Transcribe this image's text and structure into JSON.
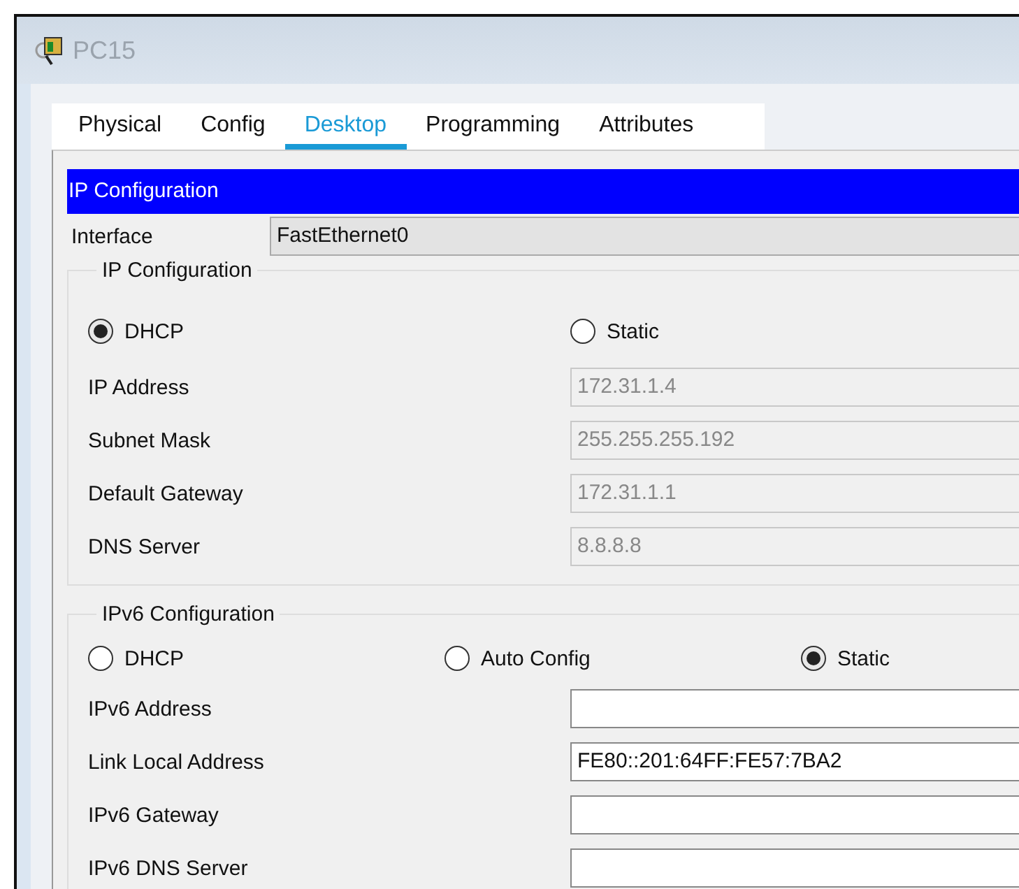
{
  "window": {
    "title": "PC15"
  },
  "tabs": [
    {
      "label": "Physical",
      "selected": false
    },
    {
      "label": "Config",
      "selected": false
    },
    {
      "label": "Desktop",
      "selected": true
    },
    {
      "label": "Programming",
      "selected": false
    },
    {
      "label": "Attributes",
      "selected": false
    }
  ],
  "header": "IP Configuration",
  "interface": {
    "label": "Interface",
    "value": "FastEthernet0"
  },
  "ipv4": {
    "title": "IP Configuration",
    "modes": [
      {
        "label": "DHCP",
        "selected": true
      },
      {
        "label": "Static",
        "selected": false
      }
    ],
    "fields": [
      {
        "label": "IP Address",
        "value": "172.31.1.4",
        "disabled": true
      },
      {
        "label": "Subnet Mask",
        "value": "255.255.255.192",
        "disabled": true
      },
      {
        "label": "Default Gateway",
        "value": "172.31.1.1",
        "disabled": true
      },
      {
        "label": "DNS Server",
        "value": "8.8.8.8",
        "disabled": true
      }
    ]
  },
  "ipv6": {
    "title": "IPv6 Configuration",
    "modes": [
      {
        "label": "DHCP",
        "selected": false
      },
      {
        "label": "Auto Config",
        "selected": false
      },
      {
        "label": "Static",
        "selected": true
      }
    ],
    "fields": [
      {
        "label": "IPv6 Address",
        "disabled": false
      },
      {
        "label": "Link Local Address",
        "value": "FE80::201:64FF:FE57:7BA2",
        "disabled": false
      },
      {
        "label": "IPv6 Gateway",
        "disabled": false
      },
      {
        "label": "IPv6 DNS Server",
        "disabled": false
      }
    ]
  }
}
